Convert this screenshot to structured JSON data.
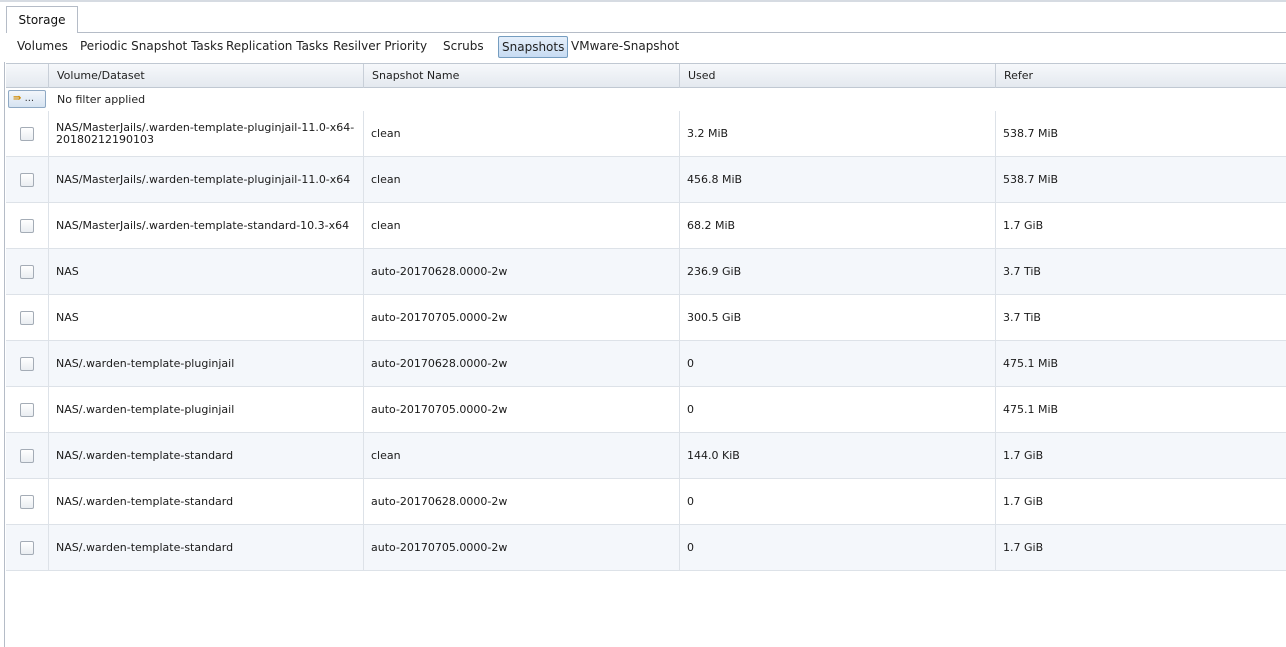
{
  "top_tab": {
    "label": "Storage"
  },
  "subtabs": [
    {
      "label": "Volumes",
      "active": false
    },
    {
      "label": "Periodic Snapshot Tasks",
      "active": false
    },
    {
      "label": "Replication Tasks",
      "active": false
    },
    {
      "label": "Resilver Priority",
      "active": false
    },
    {
      "label": "Scrubs",
      "active": false
    },
    {
      "label": "Snapshots",
      "active": true
    },
    {
      "label": "VMware-Snapshot",
      "active": false
    }
  ],
  "grid": {
    "columns": [
      "Volume/Dataset",
      "Snapshot Name",
      "Used",
      "Refer"
    ],
    "filter_button_label": "...",
    "filter_text": "No filter applied",
    "rows": [
      {
        "dataset": "NAS/MasterJails/.warden-template-pluginjail-11.0-x64-20180212190103",
        "snapshot": "clean",
        "used": "3.2 MiB",
        "refer": "538.7 MiB"
      },
      {
        "dataset": "NAS/MasterJails/.warden-template-pluginjail-11.0-x64",
        "snapshot": "clean",
        "used": "456.8 MiB",
        "refer": "538.7 MiB"
      },
      {
        "dataset": "NAS/MasterJails/.warden-template-standard-10.3-x64",
        "snapshot": "clean",
        "used": "68.2 MiB",
        "refer": "1.7 GiB"
      },
      {
        "dataset": "NAS",
        "snapshot": "auto-20170628.0000-2w",
        "used": "236.9 GiB",
        "refer": "3.7 TiB"
      },
      {
        "dataset": "NAS",
        "snapshot": "auto-20170705.0000-2w",
        "used": "300.5 GiB",
        "refer": "3.7 TiB"
      },
      {
        "dataset": "NAS/.warden-template-pluginjail",
        "snapshot": "auto-20170628.0000-2w",
        "used": "0",
        "refer": "475.1 MiB"
      },
      {
        "dataset": "NAS/.warden-template-pluginjail",
        "snapshot": "auto-20170705.0000-2w",
        "used": "0",
        "refer": "475.1 MiB"
      },
      {
        "dataset": "NAS/.warden-template-standard",
        "snapshot": "clean",
        "used": "144.0 KiB",
        "refer": "1.7 GiB"
      },
      {
        "dataset": "NAS/.warden-template-standard",
        "snapshot": "auto-20170628.0000-2w",
        "used": "0",
        "refer": "1.7 GiB"
      },
      {
        "dataset": "NAS/.warden-template-standard",
        "snapshot": "auto-20170705.0000-2w",
        "used": "0",
        "refer": "1.7 GiB"
      }
    ]
  }
}
